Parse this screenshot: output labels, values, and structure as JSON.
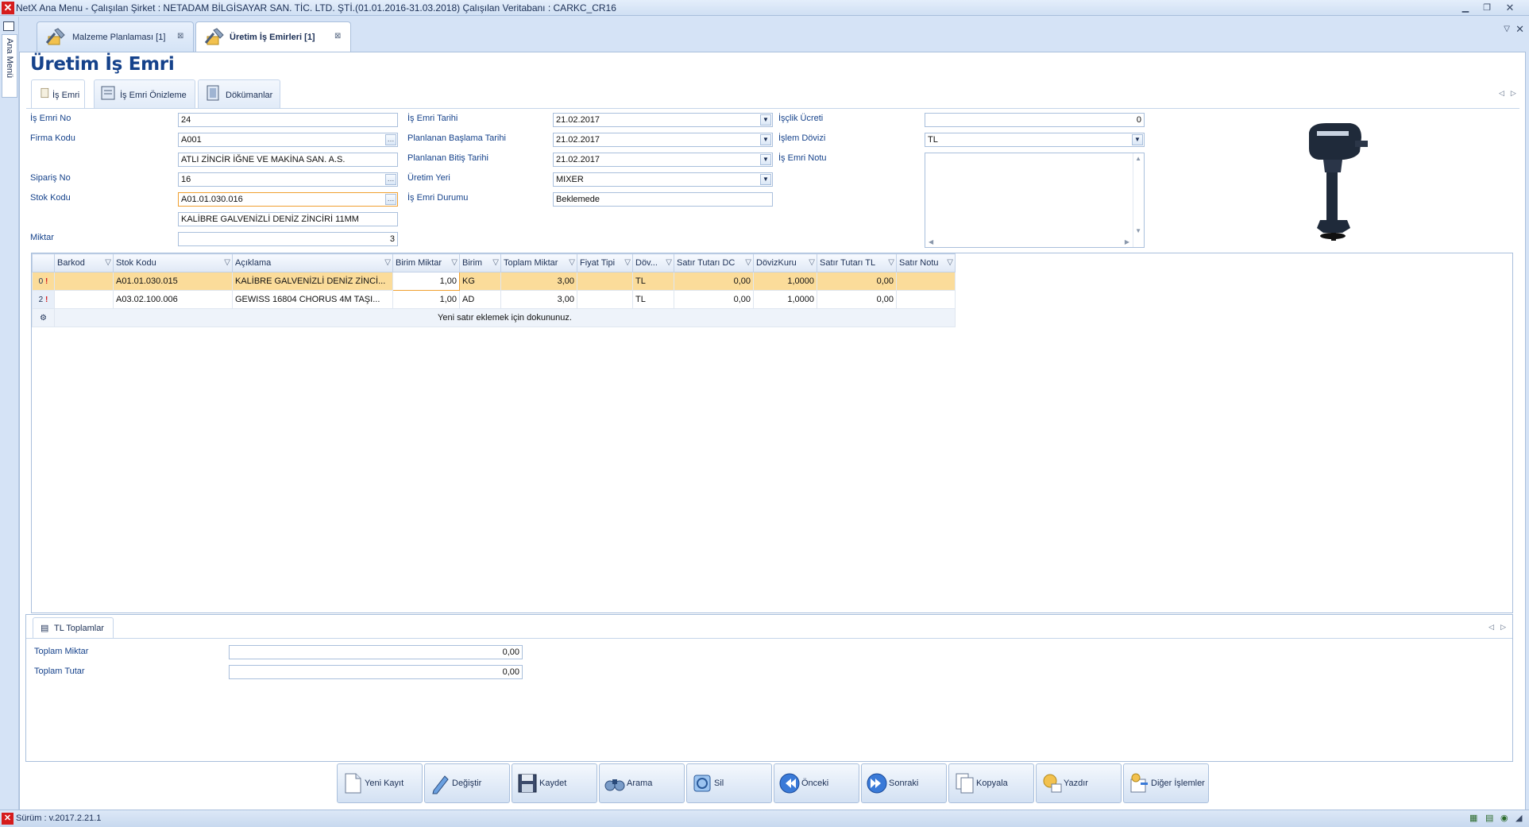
{
  "window": {
    "title": "NetX Ana Menu - Çalışılan Şirket : NETADAM BİLGİSAYAR SAN. TİC. LTD. ŞTİ.(01.01.2016-31.03.2018) Çalışılan Veritabanı : CARKC_CR16"
  },
  "sidebar": {
    "label": "Ana Menü"
  },
  "doc_tabs": [
    {
      "label": "Malzeme Planlaması [1]"
    },
    {
      "label": "Üretim İş Emirleri [1]"
    }
  ],
  "page_title": "Üretim İş Emri",
  "sub_tabs": [
    {
      "label": "İş Emri"
    },
    {
      "label": "İş Emri Önizleme"
    },
    {
      "label": "Dökümanlar"
    }
  ],
  "form": {
    "is_emri_no_label": "İş Emri No",
    "is_emri_no": "24",
    "firma_kodu_label": "Firma Kodu",
    "firma_kodu": "A001",
    "firma_adi": "ATLI ZİNCİR İĞNE VE MAKİNA SAN. A.S.",
    "siparis_no_label": "Sipariş No",
    "siparis_no": "16",
    "stok_kodu_label": "Stok Kodu",
    "stok_kodu": "A01.01.030.016",
    "stok_adi": "KALİBRE GALVENİZLİ DENİZ ZİNCİRİ 11MM",
    "miktar_label": "Miktar",
    "miktar": "3",
    "is_emri_tarihi_label": "İş Emri Tarihi",
    "is_emri_tarihi": "21.02.2017",
    "plan_baslama_label": "Planlanan Başlama Tarihi",
    "plan_baslama": "21.02.2017",
    "plan_bitis_label": "Planlanan Bitiş Tarihi",
    "plan_bitis": "21.02.2017",
    "uretim_yeri_label": "Üretim Yeri",
    "uretim_yeri": "MIXER",
    "is_emri_durumu_label": "İş Emri Durumu",
    "is_emri_durumu": "Beklemede",
    "iscilik_ucreti_label": "İşçlik Ücreti",
    "iscilik_ucreti": "0",
    "islem_dovizi_label": "İşlem Dövizi",
    "islem_dovizi": "TL",
    "is_emri_notu_label": "İş Emri Notu",
    "is_emri_notu": ""
  },
  "grid": {
    "columns": [
      "Barkod",
      "Stok Kodu",
      "Açıklama",
      "Birim Miktar",
      "Birim",
      "Toplam Miktar",
      "Fiyat Tipi",
      "Döv...",
      "Satır Tutarı DC",
      "DövizKuru",
      "Satır Tutarı TL",
      "Satır Notu"
    ],
    "rows": [
      {
        "ind": "0",
        "barkod": "",
        "stok_kodu": "A01.01.030.015",
        "aciklama": "KALİBRE GALVENİZLİ DENİZ ZİNCİ...",
        "birim_miktar": "1,00",
        "birim": "KG",
        "toplam_miktar": "3,00",
        "fiyat_tipi": "",
        "doviz": "TL",
        "tutar_dc": "0,00",
        "doviz_kuru": "1,0000",
        "tutar_tl": "0,00",
        "satir_notu": ""
      },
      {
        "ind": "2",
        "barkod": "",
        "stok_kodu": "A03.02.100.006",
        "aciklama": "GEWISS 16804 CHORUS 4M TAŞI...",
        "birim_miktar": "1,00",
        "birim": "AD",
        "toplam_miktar": "3,00",
        "fiyat_tipi": "",
        "doviz": "TL",
        "tutar_dc": "0,00",
        "doviz_kuru": "1,0000",
        "tutar_tl": "0,00",
        "satir_notu": ""
      }
    ],
    "new_row_text": "Yeni satır eklemek için dokununuz."
  },
  "totals": {
    "tab_label": "TL Toplamlar",
    "toplam_miktar_label": "Toplam Miktar",
    "toplam_miktar": "0,00",
    "toplam_tutar_label": "Toplam Tutar",
    "toplam_tutar": "0,00"
  },
  "toolbar": [
    {
      "label": "Yeni Kayıt",
      "icon": "new-document-icon"
    },
    {
      "label": "Değiştir",
      "icon": "pencil-icon"
    },
    {
      "label": "Kaydet",
      "icon": "floppy-icon"
    },
    {
      "label": "Arama",
      "icon": "binoculars-icon"
    },
    {
      "label": "Sil",
      "icon": "delete-icon"
    },
    {
      "label": "Önceki",
      "icon": "previous-icon"
    },
    {
      "label": "Sonraki",
      "icon": "next-icon"
    },
    {
      "label": "Kopyala",
      "icon": "copy-icon"
    },
    {
      "label": "Yazdır",
      "icon": "print-icon"
    },
    {
      "label": "Diğer İşlemler",
      "icon": "other-operations-icon"
    }
  ],
  "status": {
    "version": "Sürüm : v.2017.2.21.1"
  }
}
